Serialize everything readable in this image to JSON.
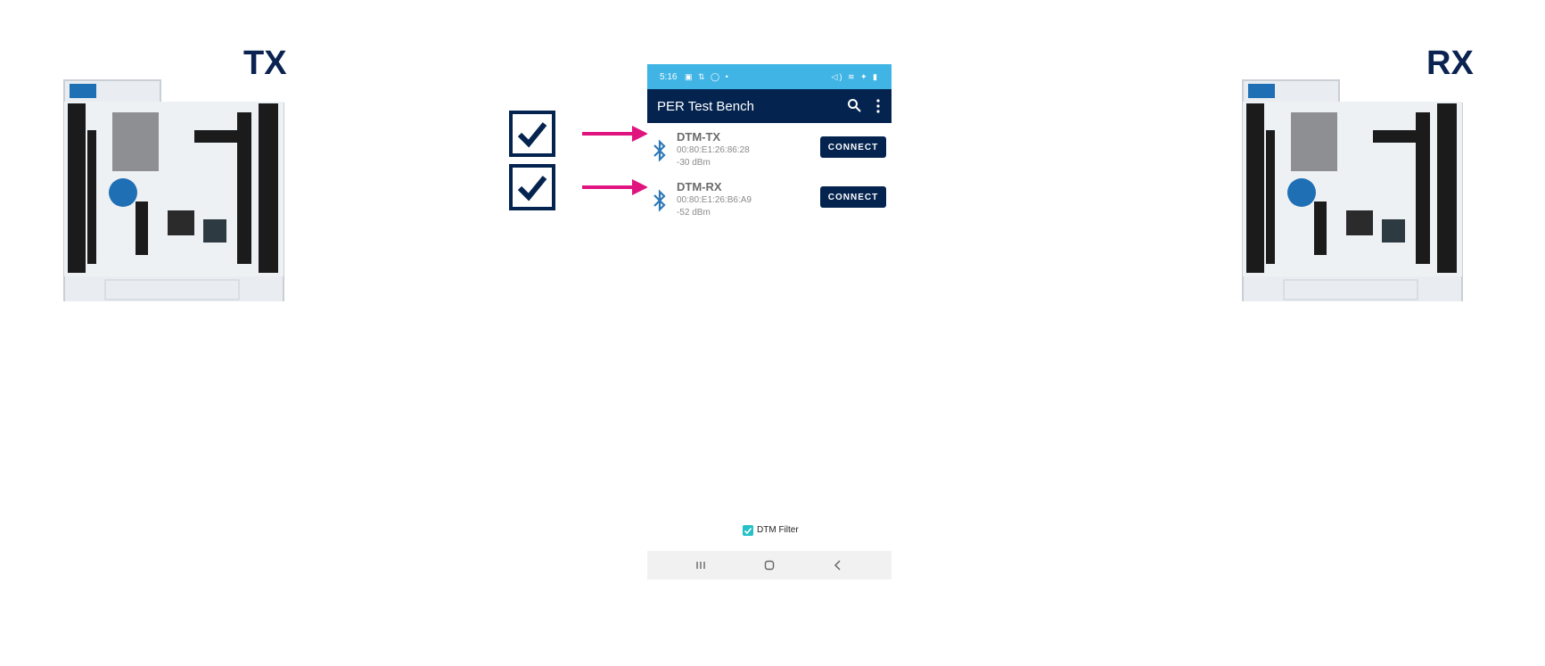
{
  "boards": {
    "tx": {
      "label": "TX"
    },
    "rx": {
      "label": "RX"
    }
  },
  "phone": {
    "status": {
      "time": "5:16",
      "left_icons": "▣ ⇅ ◯ •",
      "right_icons": "◁) ≋ ✦ ▮"
    },
    "app": {
      "title": "PER Test Bench"
    },
    "devices": [
      {
        "name": "DTM-TX",
        "address": "00:80:E1:26:86:28",
        "rssi": "-30 dBm",
        "button": "CONNECT"
      },
      {
        "name": "DTM-RX",
        "address": "00:80:E1:26:B6:A9",
        "rssi": "-52 dBm",
        "button": "CONNECT"
      }
    ],
    "filter": {
      "label": "DTM Filter",
      "checked": true
    }
  },
  "colors": {
    "navy": "#04244f",
    "status": "#3fb4e5",
    "arrow": "#e0137f",
    "check": "#26c0c7"
  },
  "icons": [
    "search-icon",
    "more-vert-icon",
    "bluetooth-icon",
    "checkbox-checked-icon",
    "recent-apps-icon",
    "home-icon",
    "back-icon"
  ]
}
